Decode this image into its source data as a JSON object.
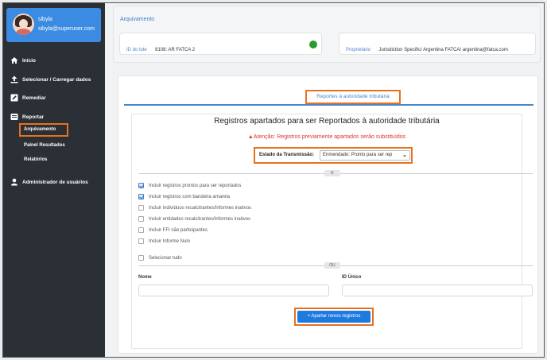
{
  "user": {
    "name": "sibyla",
    "email": "sibyla@superuser.com"
  },
  "sidebar": {
    "items": [
      {
        "label": "Início",
        "icon": "home-icon"
      },
      {
        "label": "Selecionar / Carregar dados",
        "icon": "upload-icon"
      },
      {
        "label": "Remediar",
        "icon": "edit-icon"
      },
      {
        "label": "Reportar",
        "icon": "report-icon"
      },
      {
        "label": "Administrador de usuários",
        "icon": "user-icon"
      }
    ],
    "sub_items": [
      "Arquivamento",
      "Painel Resultados",
      "Relatórios"
    ]
  },
  "header": {
    "breadcrumb": "Arquivamento",
    "lot_label": "ID do lote",
    "lot_value": "8108: AR FATCA 2",
    "owner_label": "Proprietário",
    "owner_value": "Jurisdiction Specific/ Argentina FATCA/ argentina@fatca.com"
  },
  "tab": {
    "label": "Reportes à autoridade tributária"
  },
  "form": {
    "title": "Registros apartados para ser Reportados à autoridade tributária",
    "warning": "Atenção: Registros previamente apartados serão substituídos",
    "estado_label": "Estado da Transmissão:",
    "estado_value": "Enmendado: Pronto para ser rep",
    "divider_e": "E",
    "checkboxes": [
      {
        "label": "Incluir registros prontos para ser reportados",
        "checked": true
      },
      {
        "label": "Incluir registros com bandeira amarela",
        "checked": true
      },
      {
        "label": "Incluir indivíduos recalcitrantes/Informes inativos",
        "checked": false
      },
      {
        "label": "Incluir entidades recalcitrantes/Informes inativos",
        "checked": false
      },
      {
        "label": "Incluir FFI não participantes",
        "checked": false
      },
      {
        "label": "Incluir Informe Nulo",
        "checked": false
      }
    ],
    "select_all": "Selecionar tudo",
    "divider_ou": "OU",
    "nome_label": "Nome",
    "id_label": "ID Único",
    "button": "+ Apartar novos registros"
  },
  "colors": {
    "accent": "#1f7ae0",
    "highlight": "#e8711e",
    "sidebar": "#2b2f36",
    "warning": "#d93636"
  }
}
